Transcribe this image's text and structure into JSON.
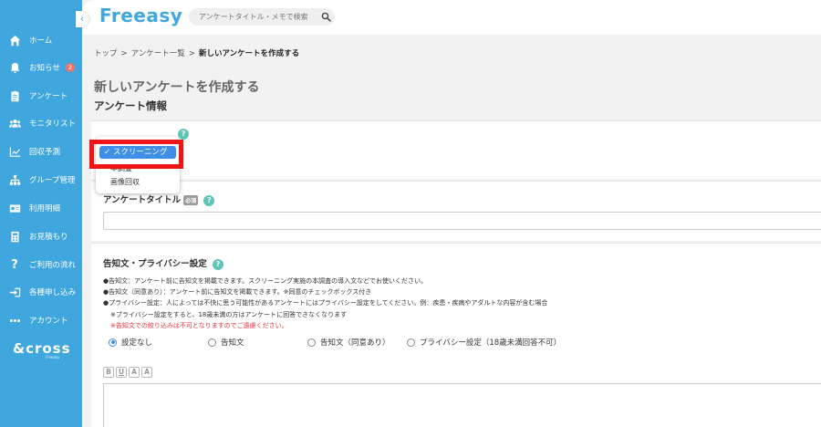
{
  "sidebar": {
    "collapse_label": "‹",
    "items": [
      {
        "label": "ホーム",
        "icon": "home-icon"
      },
      {
        "label": "お知らせ",
        "icon": "bell-icon",
        "badge": "2"
      },
      {
        "label": "アンケート",
        "icon": "clipboard-icon"
      },
      {
        "label": "モニタリスト",
        "icon": "users-icon"
      },
      {
        "label": "回収予測",
        "icon": "chart-icon"
      },
      {
        "label": "グループ管理",
        "icon": "sitemap-icon"
      },
      {
        "label": "利用明細",
        "icon": "id-card-icon"
      },
      {
        "label": "お見積もり",
        "icon": "calculator-icon"
      },
      {
        "label": "ご利用の流れ",
        "icon": "question-icon"
      },
      {
        "label": "各種申し込み",
        "icon": "sign-in-icon"
      },
      {
        "label": "アカウント",
        "icon": "more-icon"
      }
    ],
    "footer_logo": "&cross",
    "footer_sub": "Freeasy"
  },
  "header": {
    "logo": "Freeasy",
    "search_placeholder": "アンケートタイトル・メモで検索"
  },
  "breadcrumb": {
    "items": [
      "トップ",
      "アンケート一覧"
    ],
    "current": "新しいアンケートを作成する",
    "separator": ">"
  },
  "page_title": "新しいアンケートを作成する",
  "section_title": "アンケート情報",
  "survey_type": {
    "help": "?",
    "options": [
      "スクリーニング",
      "本調査",
      "画像回収"
    ],
    "selected": "スクリーニング",
    "check_mark": "✓"
  },
  "survey_title_field": {
    "label": "アンケートタイトル",
    "required_badge": "必須",
    "help": "?",
    "value": ""
  },
  "privacy": {
    "label": "告知文・プライバシー設定",
    "help": "?",
    "lines": [
      "●告知文：アンケート前に告知文を掲載できます。スクリーニング実施の本調査の導入文などでお使いください。",
      "●告知文（同意あり）：アンケート前に告知文を掲載できます。※同意のチェックボックス付き",
      "●プライバシー設定：人によっては不快に思う可能性があるアンケートにはプライバシー設定をしてください。例：疾患・疾病やアダルトな内容が含む場合",
      "※プライバシー設定をすると、18歳未満の方はアンケートに回答できなくなります"
    ],
    "warning": "※告知文での絞り込みは不可となりますのでご遠慮ください。",
    "radio_options": [
      "設定なし",
      "告知文",
      "告知文（同意あり）",
      "プライバシー設定（18歳未満回答不可）"
    ],
    "radio_selected": "設定なし",
    "editor_tools": [
      "B",
      "U",
      "A",
      "A"
    ],
    "editor_value": ""
  },
  "colors": {
    "sidebar": "#3fa6de",
    "accent": "#3f8fe7",
    "highlight": "#f01515",
    "help": "#5ec4b8"
  }
}
